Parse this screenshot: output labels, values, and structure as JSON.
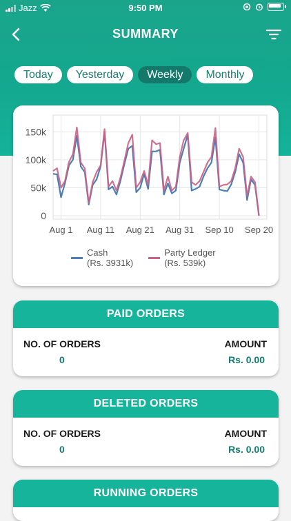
{
  "status_bar": {
    "carrier": "Jazz",
    "time": "9:50 PM"
  },
  "nav": {
    "title": "SUMMARY"
  },
  "tabs": [
    {
      "label": "Today",
      "active": false
    },
    {
      "label": "Yesterday",
      "active": false
    },
    {
      "label": "Weekly",
      "active": true
    },
    {
      "label": "Monthly",
      "active": false
    }
  ],
  "chart_data": {
    "type": "line",
    "x_ticks": [
      "Aug 1",
      "Aug 11",
      "Aug 21",
      "Aug 31",
      "Sep 10",
      "Sep 20"
    ],
    "y_ticks": [
      "0",
      "50k",
      "100k",
      "150k"
    ],
    "ylim": [
      0,
      180000
    ],
    "x_range": [
      0,
      54
    ],
    "grid": true,
    "legend_position": "bottom",
    "series": [
      {
        "name": "Cash",
        "legend_label": "Cash",
        "legend_sub": "(Rs. 3931k)",
        "color": "#4a7fb8",
        "values": [
          75000,
          74000,
          33000,
          58000,
          90000,
          100000,
          143000,
          88000,
          78000,
          20000,
          55000,
          65000,
          88000,
          150000,
          47000,
          52000,
          38000,
          62000,
          92000,
          120000,
          125000,
          42000,
          50000,
          75000,
          48000,
          115000,
          115000,
          118000,
          38000,
          58000,
          40000,
          45000,
          95000,
          120000,
          145000,
          45000,
          48000,
          52000,
          70000,
          85000,
          95000,
          140000,
          47000,
          45000,
          44000,
          56000,
          78000,
          110000,
          95000,
          28000,
          65000,
          55000,
          0
        ]
      },
      {
        "name": "Party Ledger",
        "legend_label": "Party Ledger",
        "legend_sub": "(Rs. 539k)",
        "color": "#cc6183",
        "values": [
          80000,
          85000,
          50000,
          62000,
          96000,
          110000,
          158000,
          95000,
          85000,
          23000,
          60000,
          78000,
          90000,
          155000,
          52000,
          62000,
          45000,
          68000,
          98000,
          130000,
          145000,
          50000,
          60000,
          80000,
          55000,
          135000,
          128000,
          130000,
          45000,
          70000,
          45000,
          52000,
          105000,
          135000,
          148000,
          60000,
          55000,
          62000,
          78000,
          95000,
          105000,
          157000,
          52000,
          55000,
          56000,
          62000,
          85000,
          120000,
          105000,
          35000,
          70000,
          60000,
          0
        ]
      }
    ]
  },
  "sections": {
    "paid": {
      "title": "PAID ORDERS",
      "count_label": "NO. OF ORDERS",
      "amount_label": "AMOUNT",
      "count": "0",
      "amount": "Rs. 0.00"
    },
    "deleted": {
      "title": "DELETED ORDERS",
      "count_label": "NO. OF ORDERS",
      "amount_label": "AMOUNT",
      "count": "0",
      "amount": "Rs. 0.00"
    },
    "running": {
      "title": "RUNNING ORDERS"
    }
  }
}
